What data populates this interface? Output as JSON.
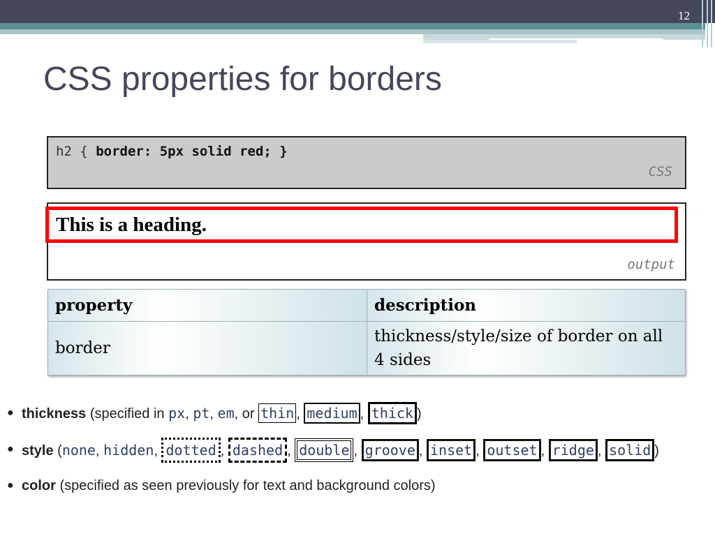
{
  "slide_number": "12",
  "title": "CSS properties for borders",
  "code_example": {
    "selector": "h2 { ",
    "declaration": "border: 5px solid red; }",
    "label": "CSS"
  },
  "output_example": {
    "heading": "This is a heading.",
    "label": "output"
  },
  "table": {
    "headers": [
      "property",
      "description"
    ],
    "rows": [
      [
        "border",
        "thickness/style/size of border on all 4 sides"
      ]
    ]
  },
  "bullets": {
    "thickness": {
      "term": "thickness",
      "intro": " (specified in ",
      "units": [
        "px",
        "pt",
        "em"
      ],
      "or": ", or ",
      "keywords": [
        "thin",
        "medium",
        "thick"
      ]
    },
    "style": {
      "term": "style",
      "intro": " (",
      "plain": [
        "none",
        "hidden"
      ],
      "keywords": [
        "dotted",
        "dashed",
        "double",
        "groove",
        "inset",
        "outset",
        "ridge",
        "solid"
      ]
    },
    "color": {
      "term": "color",
      "text": " (specified as seen previously for text and background colors)"
    }
  }
}
